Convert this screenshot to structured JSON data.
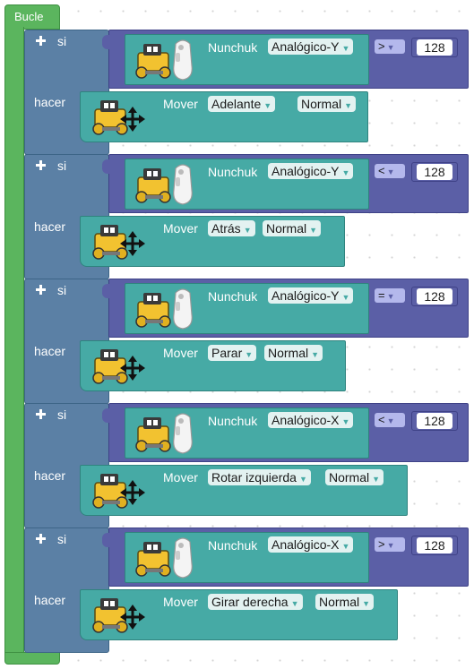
{
  "loop": {
    "label": "Bucle"
  },
  "if_label": "si",
  "do_label": "hacer",
  "sensor_label": "Nunchuk",
  "action_label": "Mover",
  "blocks": [
    {
      "axis": "Analógico-Y",
      "operator": ">",
      "value": "128",
      "direction": "Adelante",
      "speed": "Normal"
    },
    {
      "axis": "Analógico-Y",
      "operator": "<",
      "value": "128",
      "direction": "Atrás",
      "speed": "Normal"
    },
    {
      "axis": "Analógico-Y",
      "operator": "=",
      "value": "128",
      "direction": "Parar",
      "speed": "Normal"
    },
    {
      "axis": "Analógico-X",
      "operator": "<",
      "value": "128",
      "direction": "Rotar izquierda",
      "speed": "Normal"
    },
    {
      "axis": "Analógico-X",
      "operator": ">",
      "value": "128",
      "direction": "Girar derecha",
      "speed": "Normal"
    }
  ],
  "icons": {
    "robot": "robot-icon",
    "controller": "wii-nunchuk-icon",
    "move": "move-arrows-icon",
    "dropdown": "dropdown-caret-icon",
    "add": "plus-icon"
  },
  "colors": {
    "loop": "#5bb55e",
    "control": "#5b80a5",
    "logic": "#5b5fa6",
    "sensor": "#46aaa5"
  }
}
